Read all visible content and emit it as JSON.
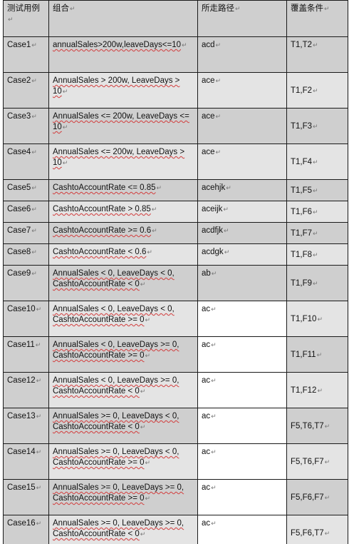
{
  "header": {
    "case": "测试用例",
    "combo": "组合",
    "path": "所走路径",
    "cover": "覆盖条件"
  },
  "rows": [
    {
      "case": "Case1",
      "combo": "annualSales>200w,leaveDays<=10",
      "path": "acd",
      "cover": "T1,T2"
    },
    {
      "case": "Case2",
      "combo": "AnnualSales > 200w, LeaveDays > 10",
      "path": "ace",
      "cover": "T1,F2"
    },
    {
      "case": "Case3",
      "combo": "AnnualSales <= 200w, LeaveDays <= 10",
      "path": "ace",
      "cover": "T1,F3"
    },
    {
      "case": "Case4",
      "combo": "AnnualSales <= 200w, LeaveDays > 10",
      "path": "ace",
      "cover": "T1,F4"
    },
    {
      "case": "Case5",
      "combo": "CashtoAccountRate <= 0.85",
      "path": "acehjk",
      "cover": "T1,F5"
    },
    {
      "case": "Case6",
      "combo": "CashtoAccountRate > 0.85",
      "path": "aceijk",
      "cover": "T1,F6"
    },
    {
      "case": "Case7",
      "combo": "CashtoAccountRate >= 0.6",
      "path": "acdfjk",
      "cover": "T1,F7"
    },
    {
      "case": "Case8",
      "combo": "CashtoAccountRate < 0.6",
      "path": "acdgk",
      "cover": "T1,F8"
    },
    {
      "case": "Case9",
      "combo": "AnnualSales < 0, LeaveDays < 0, CashtoAccountRate < 0",
      "path": "ab",
      "cover": "T1,F9"
    },
    {
      "case": "Case10",
      "combo": "AnnualSales < 0, LeaveDays < 0, CashtoAccountRate >= 0",
      "path": "ac",
      "cover": "T1,F10"
    },
    {
      "case": "Case11",
      "combo": "AnnualSales < 0, LeaveDays >= 0, CashtoAccountRate >= 0",
      "path": "ac",
      "cover": "T1,F11"
    },
    {
      "case": "Case12",
      "combo": "AnnualSales < 0, LeaveDays >= 0, CashtoAccountRate < 0",
      "path": "ac",
      "cover": "T1,F12"
    },
    {
      "case": "Case13",
      "combo": "AnnualSales >= 0, LeaveDays < 0, CashtoAccountRate < 0",
      "path": "ac",
      "cover": "F5,T6,T7"
    },
    {
      "case": "Case14",
      "combo": "AnnualSales >= 0, LeaveDays < 0, CashtoAccountRate >= 0",
      "path": "ac",
      "cover": "F5,T6,F7"
    },
    {
      "case": "Case15",
      "combo": "AnnualSales >= 0, LeaveDays >= 0, CashtoAccountRate >= 0",
      "path": "ac",
      "cover": "F5,F6,F7"
    },
    {
      "case": "Case16",
      "combo": "AnnualSales >= 0, LeaveDays >= 0, CashtoAccountRate < 0",
      "path": "ac",
      "cover": "F5,F6,T7"
    }
  ]
}
